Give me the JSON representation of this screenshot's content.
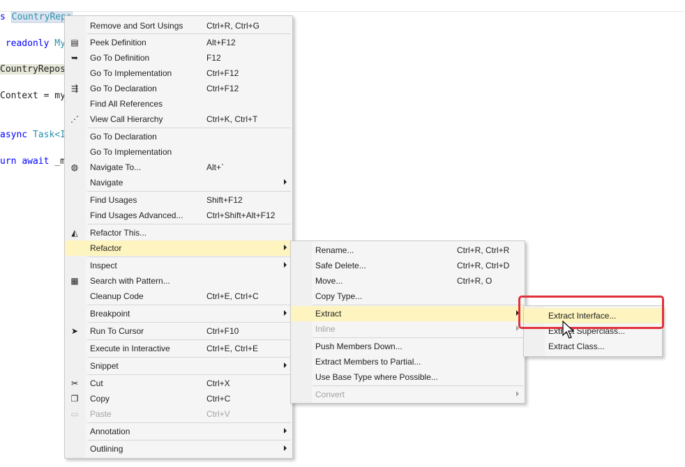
{
  "editor": {
    "code_fragments": [
      "s",
      "CountryRepo",
      "readonly",
      "My",
      "CountryRepos",
      "Context = my",
      "async",
      "Task<I",
      "urn",
      "await",
      "_m"
    ]
  },
  "main_menu": [
    {
      "label": "Remove and Sort Usings",
      "shortcut": "Ctrl+R, Ctrl+G",
      "icon": ""
    },
    {
      "label": "Peek Definition",
      "shortcut": "Alt+F12",
      "icon": "peek-definition-icon"
    },
    {
      "label": "Go To Definition",
      "shortcut": "F12",
      "icon": "go-to-definition-icon"
    },
    {
      "label": "Go To Implementation",
      "shortcut": "Ctrl+F12",
      "icon": ""
    },
    {
      "label": "Go To Declaration",
      "shortcut": "Ctrl+F12",
      "icon": "go-to-declaration-icon"
    },
    {
      "label": "Find All References",
      "shortcut": "",
      "icon": ""
    },
    {
      "label": "View Call Hierarchy",
      "shortcut": "Ctrl+K, Ctrl+T",
      "icon": "call-hierarchy-icon"
    },
    {
      "label": "Go To Declaration",
      "shortcut": "",
      "icon": ""
    },
    {
      "label": "Go To Implementation",
      "shortcut": "",
      "icon": ""
    },
    {
      "label": "Navigate To...",
      "shortcut": "Alt+`",
      "icon": "navigate-to-icon"
    },
    {
      "label": "Navigate",
      "shortcut": "",
      "icon": "",
      "submenu": true
    },
    {
      "label": "Find Usages",
      "shortcut": "Shift+F12",
      "icon": ""
    },
    {
      "label": "Find Usages Advanced...",
      "shortcut": "Ctrl+Shift+Alt+F12",
      "icon": ""
    },
    {
      "label": "Refactor This...",
      "shortcut": "",
      "icon": "refactor-this-icon"
    },
    {
      "label": "Refactor",
      "shortcut": "",
      "icon": "",
      "submenu": true,
      "selected": true
    },
    {
      "label": "Inspect",
      "shortcut": "",
      "icon": "",
      "submenu": true
    },
    {
      "label": "Search with Pattern...",
      "shortcut": "",
      "icon": "search-pattern-icon"
    },
    {
      "label": "Cleanup Code",
      "shortcut": "Ctrl+E, Ctrl+C",
      "icon": ""
    },
    {
      "label": "Breakpoint",
      "shortcut": "",
      "icon": "",
      "submenu": true
    },
    {
      "label": "Run To Cursor",
      "shortcut": "Ctrl+F10",
      "icon": "run-to-cursor-icon"
    },
    {
      "label": "Execute in Interactive",
      "shortcut": "Ctrl+E, Ctrl+E",
      "icon": ""
    },
    {
      "label": "Snippet",
      "shortcut": "",
      "icon": "",
      "submenu": true
    },
    {
      "label": "Cut",
      "shortcut": "Ctrl+X",
      "icon": "cut-icon"
    },
    {
      "label": "Copy",
      "shortcut": "Ctrl+C",
      "icon": "copy-icon"
    },
    {
      "label": "Paste",
      "shortcut": "Ctrl+V",
      "icon": "paste-icon",
      "disabled": true
    },
    {
      "label": "Annotation",
      "shortcut": "",
      "icon": "",
      "submenu": true
    },
    {
      "label": "Outlining",
      "shortcut": "",
      "icon": "",
      "submenu": true
    }
  ],
  "refactor_menu": [
    {
      "label": "Rename...",
      "shortcut": "Ctrl+R, Ctrl+R"
    },
    {
      "label": "Safe Delete...",
      "shortcut": "Ctrl+R, Ctrl+D"
    },
    {
      "label": "Move...",
      "shortcut": "Ctrl+R, O"
    },
    {
      "label": "Copy Type...",
      "shortcut": ""
    },
    {
      "label": "Extract",
      "shortcut": "",
      "submenu": true,
      "selected": true
    },
    {
      "label": "Inline",
      "shortcut": "",
      "submenu": true,
      "disabled": true
    },
    {
      "label": "Push Members Down...",
      "shortcut": ""
    },
    {
      "label": "Extract Members to Partial...",
      "shortcut": ""
    },
    {
      "label": "Use Base Type where Possible...",
      "shortcut": ""
    },
    {
      "label": "Convert",
      "shortcut": "",
      "submenu": true,
      "disabled": true
    }
  ],
  "extract_menu": [
    {
      "label": "Extract Interface...",
      "selected": true
    },
    {
      "label": "Extract Superclass..."
    },
    {
      "label": "Extract Class..."
    }
  ],
  "colors": {
    "highlight": "#fdf4bf",
    "annotation_box": "#e0313a"
  }
}
